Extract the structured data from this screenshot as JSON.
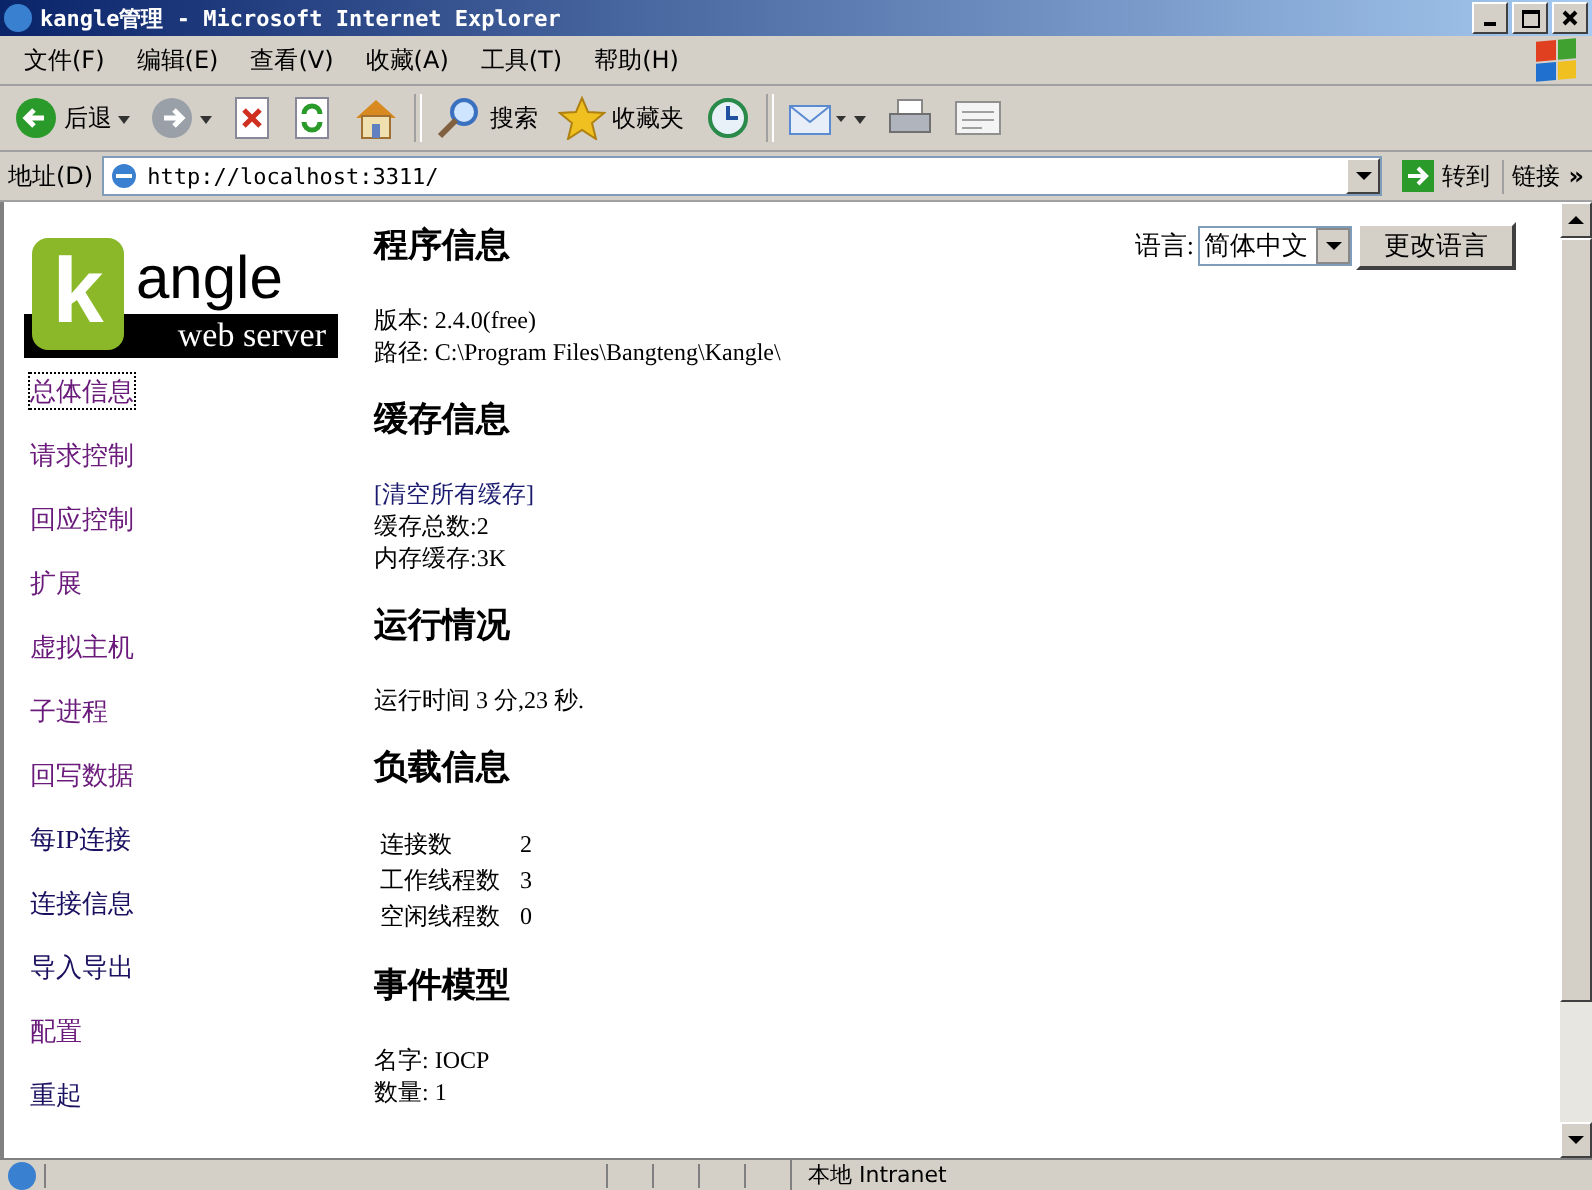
{
  "window": {
    "title": "kangle管理 - Microsoft Internet Explorer"
  },
  "menu": [
    "文件(F)",
    "编辑(E)",
    "查看(V)",
    "收藏(A)",
    "工具(T)",
    "帮助(H)"
  ],
  "toolbar": [
    {
      "kind": "back",
      "label": "后退"
    },
    {
      "kind": "forward"
    },
    {
      "kind": "stop"
    },
    {
      "kind": "refresh"
    },
    {
      "kind": "home"
    },
    {
      "kind": "search",
      "label": "搜索"
    },
    {
      "kind": "favorites",
      "label": "收藏夹"
    },
    {
      "kind": "history"
    },
    {
      "kind": "mail"
    },
    {
      "kind": "print"
    },
    {
      "kind": "edit"
    }
  ],
  "address": {
    "label": "地址(D)",
    "value": "http://localhost:3311/",
    "go": "转到",
    "links": "链接",
    "more": "»"
  },
  "logo": {
    "word": "angle",
    "letter": "k",
    "tagline": "web server"
  },
  "nav": [
    {
      "label": "总体信息",
      "selected": true,
      "visited": true
    },
    {
      "label": "请求控制",
      "selected": false,
      "visited": true
    },
    {
      "label": "回应控制",
      "selected": false,
      "visited": true
    },
    {
      "label": "扩展",
      "selected": false,
      "visited": true
    },
    {
      "label": "虚拟主机",
      "selected": false,
      "visited": true
    },
    {
      "label": "子进程",
      "selected": false,
      "visited": true
    },
    {
      "label": "回写数据",
      "selected": false,
      "visited": true
    },
    {
      "label": "每IP连接",
      "selected": false,
      "visited": false
    },
    {
      "label": "连接信息",
      "selected": false,
      "visited": false
    },
    {
      "label": "导入导出",
      "selected": false,
      "visited": false
    },
    {
      "label": "配置",
      "selected": false,
      "visited": true
    },
    {
      "label": "重起",
      "selected": false,
      "visited": false
    }
  ],
  "language": {
    "label": "语言:",
    "value": "简体中文",
    "button": "更改语言"
  },
  "sections": [
    {
      "title": "程序信息",
      "items": [
        {
          "kind": "text",
          "text": "版本: 2.4.0(free)"
        },
        {
          "kind": "text",
          "text": "路径: C:\\Program Files\\Bangteng\\Kangle\\"
        }
      ]
    },
    {
      "title": "缓存信息",
      "items": [
        {
          "kind": "link",
          "text": "[清空所有缓存]"
        },
        {
          "kind": "text",
          "text": "缓存总数:2"
        },
        {
          "kind": "text",
          "text": "内存缓存:3K"
        }
      ]
    },
    {
      "title": "运行情况",
      "items": [
        {
          "kind": "text",
          "text": "运行时间  3 分,23 秒."
        }
      ]
    },
    {
      "title": "负载信息",
      "items": [
        {
          "kind": "row",
          "text": "连接数",
          "value": "2"
        },
        {
          "kind": "row",
          "text": "工作线程数",
          "value": "3"
        },
        {
          "kind": "row",
          "text": "空闲线程数",
          "value": "0"
        }
      ]
    },
    {
      "title": "事件模型",
      "items": [
        {
          "kind": "text",
          "text": "名字: IOCP"
        },
        {
          "kind": "text",
          "text": "数量: 1"
        }
      ]
    }
  ],
  "status_bar": {
    "zone": "本地 Intranet"
  }
}
